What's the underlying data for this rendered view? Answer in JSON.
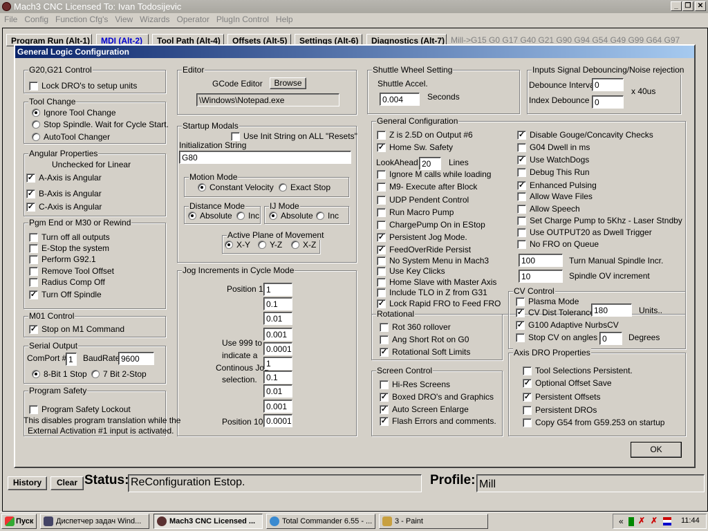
{
  "app": {
    "title": "Mach3 CNC  Licensed To: Ivan Todosijevic",
    "menu": [
      "File",
      "Config",
      "Function Cfg's",
      "View",
      "Wizards",
      "Operator",
      "PlugIn Control",
      "Help"
    ],
    "tabs": [
      "Program Run (Alt-1)",
      "MDI (Alt-2)",
      "Tool Path (Alt-4)",
      "Offsets (Alt-5)",
      "Settings (Alt-6)",
      "Diagnostics (Alt-7)"
    ],
    "active_tab": "MDI (Alt-2)",
    "gcodes": "Mill->G15  G0 G17 G40 G21 G90 G94 G54 G49 G99 G64 G97",
    "history": "History",
    "clear": "Clear",
    "status_label": "Status:",
    "status": "ReConfiguration Estop.",
    "profile_label": "Profile:",
    "profile": "Mill"
  },
  "dialog": {
    "title": "General Logic Configuration",
    "ok": "OK",
    "browse": "Browse"
  },
  "groups": {
    "g20": "G20,G21 Control",
    "tool": "Tool Change",
    "ang": "Angular Properties",
    "pgm": "Pgm End or M30 or Rewind",
    "m01": "M01 Control",
    "serial": "Serial Output",
    "safety": "Program Safety",
    "editor": "Editor",
    "modals": "Startup Modals",
    "motion": "Motion Mode",
    "dist": "Distance Mode",
    "ij": "IJ Mode",
    "plane": "Active Plane of Movement",
    "jog": "Jog Increments in Cycle Mode",
    "shuttle": "Shuttle Wheel Setting",
    "debounce": "Inputs Signal Debouncing/Noise rejection",
    "general": "General Configuration",
    "rot": "Rotational",
    "screen": "Screen Control",
    "cv": "CV Control",
    "dro": "Axis DRO Properties"
  },
  "checks": {
    "lock_dro": {
      "label": "Lock DRO's to setup units",
      "checked": false
    },
    "a_ang": {
      "label": "A-Axis is Angular",
      "checked": true
    },
    "b_ang": {
      "label": "B-Axis is Angular",
      "checked": true
    },
    "c_ang": {
      "label": "C-Axis is Angular",
      "checked": true
    },
    "off_outputs": {
      "label": "Turn off all outputs",
      "checked": false
    },
    "estop": {
      "label": "E-Stop the system",
      "checked": false
    },
    "g921": {
      "label": "Perform G92.1",
      "checked": false
    },
    "rm_tool": {
      "label": "Remove Tool Offset",
      "checked": false
    },
    "radius": {
      "label": "Radius Comp Off",
      "checked": false
    },
    "spindle_off": {
      "label": "Turn Off Spindle",
      "checked": true
    },
    "m1": {
      "label": "Stop on M1 Command",
      "checked": true
    },
    "safety": {
      "label": "Program Safety Lockout",
      "checked": false
    },
    "init_all": {
      "label": "Use Init String on ALL  \"Resets\"",
      "checked": false
    },
    "z25": {
      "label": "Z is 2.5D on Output #6",
      "checked": false
    },
    "home_safety": {
      "label": "Home Sw. Safety",
      "checked": true
    },
    "ignore_m": {
      "label": "Ignore M calls while loading",
      "checked": false
    },
    "m9": {
      "label": "M9- Execute after Block",
      "checked": false
    },
    "udp": {
      "label": "UDP Pendent Control",
      "checked": false
    },
    "macro_pump": {
      "label": "Run Macro Pump",
      "checked": false
    },
    "chargepump": {
      "label": "ChargePump On in EStop",
      "checked": false
    },
    "jog_persist": {
      "label": "Persistent Jog Mode.",
      "checked": true
    },
    "fro_persist": {
      "label": "FeedOverRide Persist",
      "checked": true
    },
    "no_sysmenu": {
      "label": "No System Menu in Mach3",
      "checked": false
    },
    "key_clicks": {
      "label": "Use Key Clicks",
      "checked": false
    },
    "home_slave": {
      "label": "Home Slave with Master Axis",
      "checked": false
    },
    "tlo": {
      "label": "Include TLO in Z from G31",
      "checked": false
    },
    "lock_rapid": {
      "label": "Lock Rapid FRO to Feed FRO",
      "checked": true
    },
    "gouge": {
      "label": "Disable Gouge/Concavity Checks",
      "checked": true
    },
    "g04": {
      "label": "G04 Dwell in ms",
      "checked": false
    },
    "watchdogs": {
      "label": "Use WatchDogs",
      "checked": true
    },
    "debug": {
      "label": "Debug This Run",
      "checked": false
    },
    "pulsing": {
      "label": "Enhanced Pulsing",
      "checked": true
    },
    "wave": {
      "label": "Allow Wave Files",
      "checked": false
    },
    "speech": {
      "label": "Allow Speech",
      "checked": false
    },
    "pump5k": {
      "label": "Set Charge Pump to 5Khz  - Laser Stndby",
      "checked": false
    },
    "out20": {
      "label": "Use OUTPUT20 as Dwell Trigger",
      "checked": false
    },
    "nofro": {
      "label": "No FRO on Queue",
      "checked": false
    },
    "plasma": {
      "label": "Plasma Mode",
      "checked": false
    },
    "cvdist": {
      "label": "CV Dist Tolerance",
      "checked": true
    },
    "g100": {
      "label": "G100 Adaptive NurbsCV",
      "checked": true
    },
    "stopcv": {
      "label": "Stop CV on angles >",
      "checked": false
    },
    "rot360": {
      "label": "Rot 360 rollover",
      "checked": false
    },
    "angshort": {
      "label": "Ang Short Rot on G0",
      "checked": false
    },
    "rotsoft": {
      "label": "Rotational Soft Limits",
      "checked": true
    },
    "hires": {
      "label": "Hi-Res Screens",
      "checked": false
    },
    "boxed": {
      "label": "Boxed DRO's and Graphics",
      "checked": true
    },
    "enlarge": {
      "label": "Auto Screen Enlarge",
      "checked": true
    },
    "flash": {
      "label": "Flash Errors and comments.",
      "checked": true
    },
    "toolsel": {
      "label": "Tool Selections Persistent.",
      "checked": false
    },
    "optoffset": {
      "label": "Optional Offset Save",
      "checked": true
    },
    "persoffsets": {
      "label": "Persistent Offsets",
      "checked": true
    },
    "persdros": {
      "label": "Persistent DROs",
      "checked": false
    },
    "copyg54": {
      "label": "Copy G54 from G59.253 on startup",
      "checked": false
    }
  },
  "radios": {
    "ignore_tc": {
      "label": "Ignore Tool Change",
      "checked": true
    },
    "stop_spindle": {
      "label": "Stop Spindle. Wait for Cycle Start.",
      "checked": false
    },
    "autotool": {
      "label": "AutoTool Changer",
      "checked": false
    },
    "bit8": {
      "label": "8-Bit 1 Stop",
      "checked": true
    },
    "bit7": {
      "label": "7 Bit 2-Stop",
      "checked": false
    },
    "cv": {
      "label": "Constant Velocity",
      "checked": true
    },
    "exact": {
      "label": "Exact Stop",
      "checked": false
    },
    "d_abs": {
      "label": "Absolute",
      "checked": true
    },
    "d_inc": {
      "label": "Inc",
      "checked": false
    },
    "ij_abs": {
      "label": "Absolute",
      "checked": true
    },
    "ij_inc": {
      "label": "Inc",
      "checked": false
    },
    "xy": {
      "label": "X-Y",
      "checked": true
    },
    "yz": {
      "label": "Y-Z",
      "checked": false
    },
    "xz": {
      "label": "X-Z",
      "checked": false
    }
  },
  "texts": {
    "unchecked_linear": "Unchecked for Linear",
    "comport": "ComPort #",
    "baudrate": "BaudRate",
    "safety1": "This disables program translation while the",
    "safety2": "External Activation #1 input is activated.",
    "gcode_editor": "GCode Editor",
    "init_string": "Initialization String",
    "pos1": "Position 1",
    "pos10": "Position 10",
    "jog1": "Use 999 to",
    "jog2": "indicate a",
    "jog3": "Continous Jog",
    "jog4": "selection.",
    "shuttle_accel": "Shuttle Accel.",
    "seconds": "Seconds",
    "debounce_int": "Debounce Interval:",
    "index_deb": "Index Debounce",
    "x40us": "x 40us",
    "lookahead": "LookAhead",
    "lines": "Lines",
    "spindle_incr": "Turn Manual Spindle Incr.",
    "spindle_ov": "Spindle OV increment",
    "units": "Units..",
    "degrees": "Degrees"
  },
  "inputs": {
    "comport": "1",
    "baud": "9600",
    "editor_path": "\\Windows\\Notepad.exe",
    "init": "G80",
    "shuttle": "0.004",
    "debounce": "0",
    "index": "0",
    "lookahead": "20",
    "spindle_incr": "100",
    "spindle_ov": "10",
    "cvdist": "180",
    "stopcv": "0",
    "jog": [
      "1",
      "0.1",
      "0.01",
      "0.001",
      "0.0001",
      "1",
      "0.1",
      "0.01",
      "0.001",
      "0.0001"
    ]
  },
  "taskbar": {
    "start": "Пуск",
    "items": [
      "Диспетчер задач Wind...",
      "Mach3 CNC  Licensed ...",
      "Total Commander 6.55 - ...",
      "3 - Paint"
    ],
    "clock": "11:44"
  }
}
